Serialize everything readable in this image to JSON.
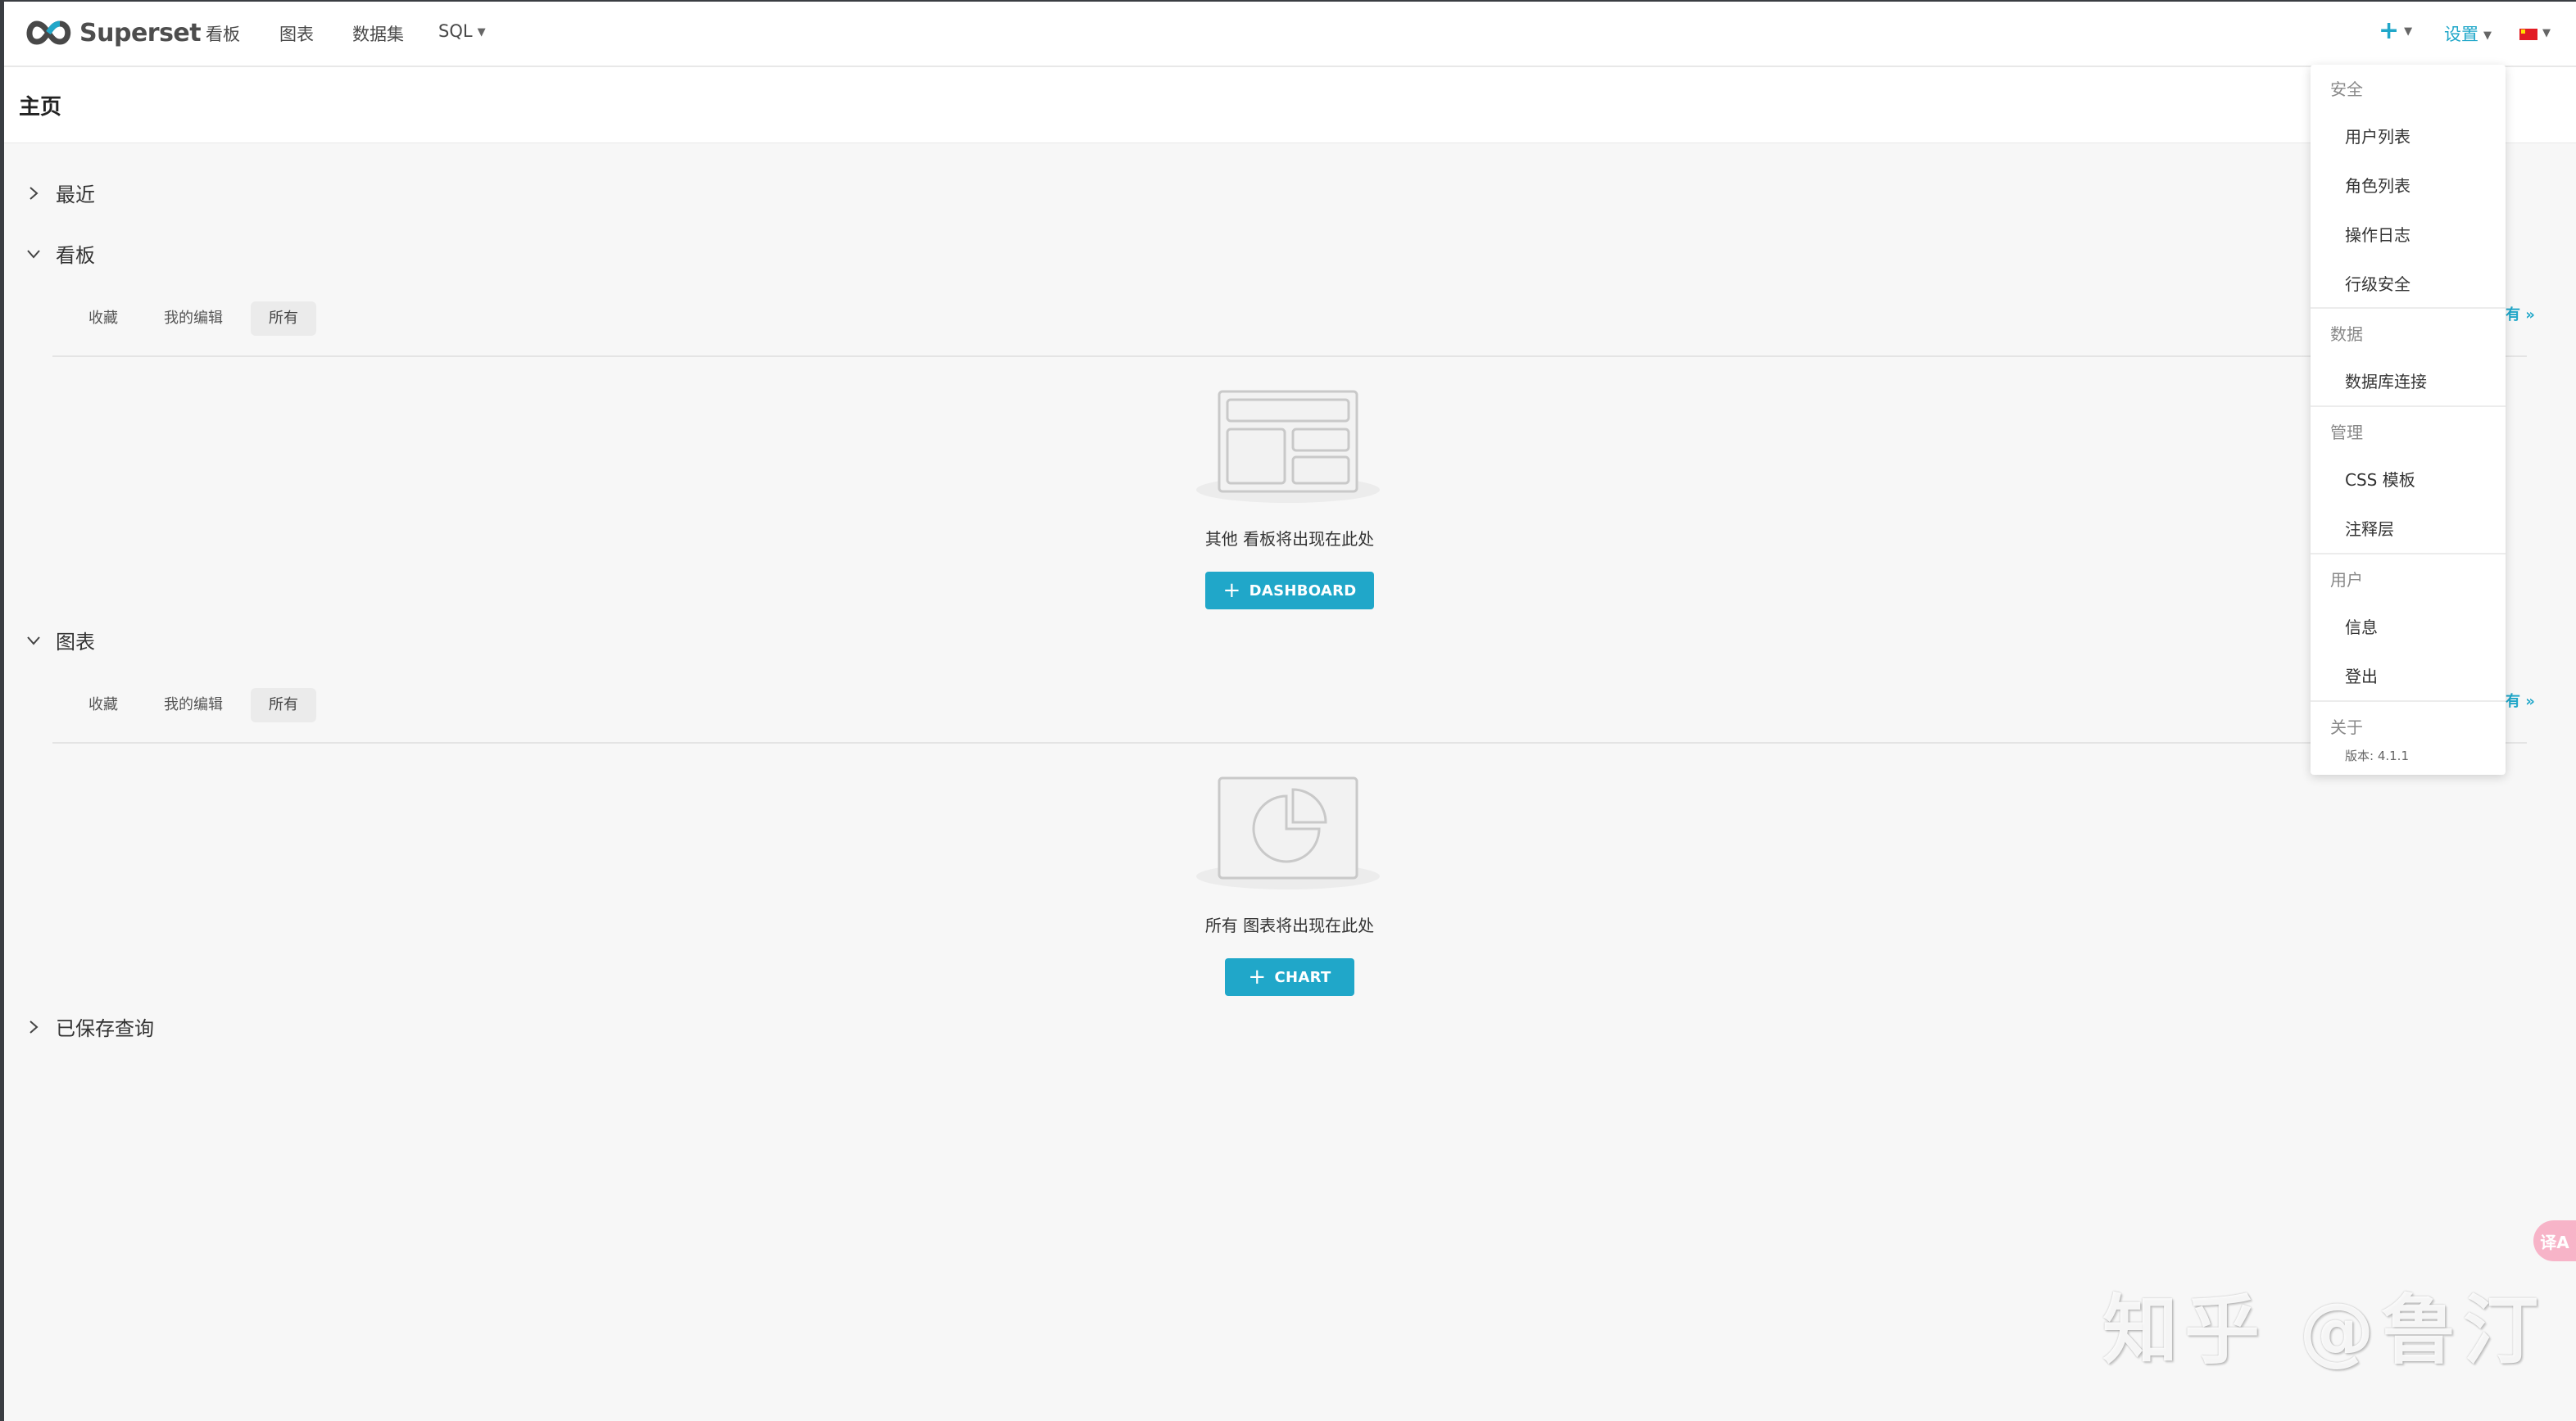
{
  "navbar": {
    "brand": "Superset",
    "items": [
      "看板",
      "图表",
      "数据集",
      "SQL"
    ],
    "settings_label": "设置"
  },
  "page": {
    "title": "主页"
  },
  "sections": {
    "recent": {
      "label": "最近",
      "expanded": false
    },
    "dashboards": {
      "label": "看板",
      "expanded": true,
      "tabs": [
        "收藏",
        "我的编辑",
        "所有"
      ],
      "active_tab": "所有",
      "view_all": "有 »",
      "empty_text": "其他 看板将出现在此处",
      "button_label": "DASHBOARD"
    },
    "charts": {
      "label": "图表",
      "expanded": true,
      "tabs": [
        "收藏",
        "我的编辑",
        "所有"
      ],
      "active_tab": "所有",
      "view_all": "有 »",
      "empty_text": "所有 图表将出现在此处",
      "button_label": "CHART"
    },
    "saved_queries": {
      "label": "已保存查询",
      "expanded": false
    }
  },
  "settings_menu": {
    "groups": [
      {
        "title": "安全",
        "items": [
          "用户列表",
          "角色列表",
          "操作日志",
          "行级安全"
        ]
      },
      {
        "title": "数据",
        "items": [
          "数据库连接"
        ]
      },
      {
        "title": "管理",
        "items": [
          "CSS 模板",
          "注释层"
        ]
      },
      {
        "title": "用户",
        "items": [
          "信息",
          "登出"
        ]
      },
      {
        "title": "关于",
        "items": []
      }
    ],
    "version": "版本: 4.1.1"
  },
  "watermark": "知乎 @鲁汀",
  "translate_icon": "译A",
  "colors": {
    "primary": "#20a7c9",
    "background": "#f7f7f7"
  }
}
